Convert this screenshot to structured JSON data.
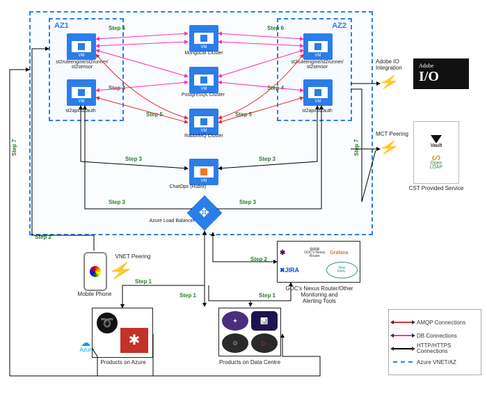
{
  "zones": {
    "az1_title": "AZ1",
    "az2_title": "AZ2"
  },
  "vm_label": "VM",
  "nodes": {
    "az1_top": "st2ruleengine/st2runner/\nst2sensor",
    "az1_bottom": "st2api/st2auth",
    "az2_top": "st2ruleengine/st2runner/\nst2sensor",
    "az2_bottom": "st2api/st2auth",
    "mongo": "MongoDB Cluster",
    "postgres": "PostgreSQL Cluster",
    "rabbit": "RabbitMQ Cluster",
    "chatops": "ChatOps (Hubot)",
    "lb": "Azure Load Balancer",
    "mobile": "Mobile Phone",
    "products_azure": "Products on Azure",
    "products_dc": "Products on Data Centre",
    "goc": "GOC's Nexus Router/Other\nMonitoring and\nAlerting Tools",
    "adobe_io_title": "Adobe IO\nIntegration",
    "mct": "MCT Peering",
    "cst": "CST Provided Service",
    "vnet_peering": "VNET Peering"
  },
  "goc_internal": {
    "slack": "slack",
    "nexus": "GOC's Nexus\nRouter",
    "grafana": "Grafana",
    "jira": "JIRA",
    "newrelic": "New\nRelic."
  },
  "external": {
    "adobe_brand": "Adobe",
    "adobe_io": "I/O",
    "vault": "Vault",
    "openldap": "Open\nLDAP"
  },
  "azure_tag": "Azure",
  "steps": {
    "s1": "Step 1",
    "s2": "Step 2",
    "s3": "Step 3",
    "s4": "Step 4",
    "s5": "Step 5",
    "s6": "Step 6",
    "s7": "Step 7"
  },
  "legend": {
    "amqp": "AMQP Connections",
    "db": "DB Connections",
    "http": "HTTP/HTTPS\nConnections",
    "vnet": "Azure VNET/AZ"
  }
}
